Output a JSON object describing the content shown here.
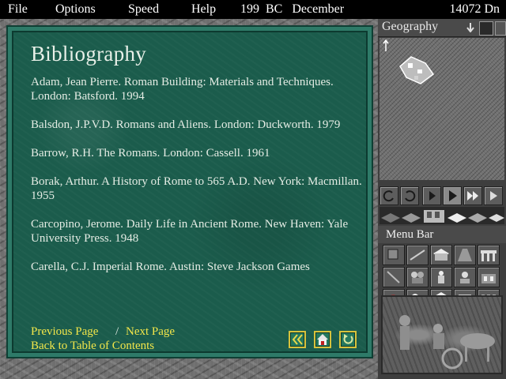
{
  "menubar": {
    "items": [
      "File",
      "Options",
      "Speed",
      "Help"
    ],
    "date": "199  BC   December",
    "treasury": "14072 Dn"
  },
  "side": {
    "overlay_label": "Geography",
    "menu_bar_label": "Menu Bar"
  },
  "panel": {
    "title": "Bibliography",
    "entries": [
      "Adam, Jean Pierre. Roman Building: Materials and Techniques. London: Batsford. 1994",
      "Balsdon, J.P.V.D. Romans and Aliens. London: Duckworth. 1979",
      "Barrow, R.H. The Romans. London: Cassell. 1961",
      "Borak, Arthur. A History of Rome to 565 A.D. New York: Macmillan. 1955",
      "Carcopino, Jerome. Daily Life in Ancient Rome. New Haven: Yale University Press. 1948",
      "Carella, C.J. Imperial Rome. Austin: Steve Jackson Games"
    ],
    "prev_label": "Previous Page",
    "separator": "/",
    "next_label": "Next Page",
    "toc_label": "Back to Table of Contents",
    "colors": {
      "panel": "#1b5c4c",
      "link": "#f2e64a",
      "text": "#e4ece4"
    }
  }
}
